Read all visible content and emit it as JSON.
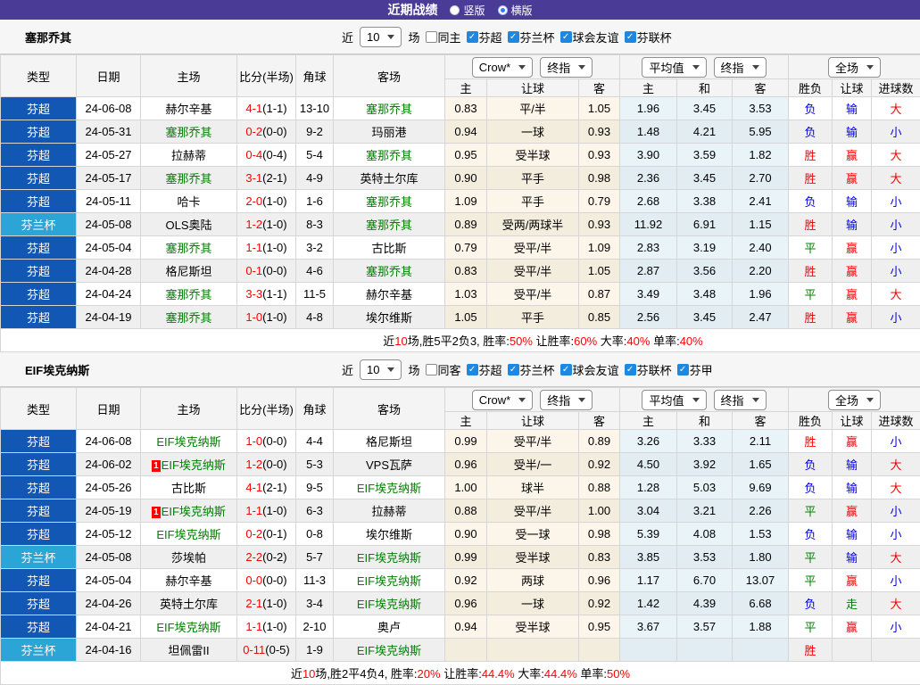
{
  "title_bar": {
    "title": "近期战绩",
    "options": [
      {
        "label": "竖版",
        "selected": false
      },
      {
        "label": "横版",
        "selected": true
      }
    ]
  },
  "columns": {
    "main": [
      "类型",
      "日期",
      "主场",
      "比分(半场)",
      "角球",
      "客场"
    ],
    "sub": [
      "主",
      "让球",
      "客",
      "主",
      "和",
      "客",
      "胜负",
      "让球",
      "进球数"
    ]
  },
  "colors": {
    "header_bar": "#4a3b96",
    "league_super": "#1257b4",
    "league_cup": "#2ba5d5",
    "win_red": "#ff0000",
    "loss_blue": "#0000ee",
    "draw_green": "#008000",
    "team_green": "#008000"
  },
  "sections": [
    {
      "team": "塞那乔其",
      "filter": {
        "near_label": "近",
        "count": "10",
        "games_label": "场",
        "same_label": "同主",
        "same_checked": false,
        "leagues": [
          {
            "label": "芬超",
            "checked": true
          },
          {
            "label": "芬兰杯",
            "checked": true
          },
          {
            "label": "球会友谊",
            "checked": true
          },
          {
            "label": "芬联杯",
            "checked": true
          }
        ]
      },
      "dropdowns": {
        "asia_source": "Crow*",
        "asia_time": "终指",
        "euro_source": "平均值",
        "euro_time": "终指",
        "scope": "全场"
      },
      "rows": [
        {
          "league": "芬超",
          "cup": false,
          "date": "24-06-08",
          "home": "赫尔辛基",
          "home_green": false,
          "home_red_card": false,
          "score": "4-1",
          "half": "(1-1)",
          "corner": "13-10",
          "away": "塞那乔其",
          "away_green": true,
          "asia": [
            "0.83",
            "平/半",
            "1.05"
          ],
          "euro": [
            "1.96",
            "3.45",
            "3.53"
          ],
          "results": [
            "负",
            "输",
            "大"
          ],
          "result_colors": [
            "b",
            "b",
            "r"
          ]
        },
        {
          "league": "芬超",
          "cup": false,
          "date": "24-05-31",
          "home": "塞那乔其",
          "home_green": true,
          "home_red_card": false,
          "score": "0-2",
          "half": "(0-0)",
          "corner": "9-2",
          "away": "玛丽港",
          "away_green": false,
          "asia": [
            "0.94",
            "一球",
            "0.93"
          ],
          "euro": [
            "1.48",
            "4.21",
            "5.95"
          ],
          "results": [
            "负",
            "输",
            "小"
          ],
          "result_colors": [
            "b",
            "b",
            "b"
          ]
        },
        {
          "league": "芬超",
          "cup": false,
          "date": "24-05-27",
          "home": "拉赫蒂",
          "home_green": false,
          "home_red_card": false,
          "score": "0-4",
          "half": "(0-4)",
          "corner": "5-4",
          "away": "塞那乔其",
          "away_green": true,
          "asia": [
            "0.95",
            "受半球",
            "0.93"
          ],
          "euro": [
            "3.90",
            "3.59",
            "1.82"
          ],
          "results": [
            "胜",
            "赢",
            "大"
          ],
          "result_colors": [
            "r",
            "r",
            "r"
          ]
        },
        {
          "league": "芬超",
          "cup": false,
          "date": "24-05-17",
          "home": "塞那乔其",
          "home_green": true,
          "home_red_card": false,
          "score": "3-1",
          "half": "(2-1)",
          "corner": "4-9",
          "away": "英特土尔库",
          "away_green": false,
          "asia": [
            "0.90",
            "平手",
            "0.98"
          ],
          "euro": [
            "2.36",
            "3.45",
            "2.70"
          ],
          "results": [
            "胜",
            "赢",
            "大"
          ],
          "result_colors": [
            "r",
            "r",
            "r"
          ]
        },
        {
          "league": "芬超",
          "cup": false,
          "date": "24-05-11",
          "home": "哈卡",
          "home_green": false,
          "home_red_card": false,
          "score": "2-0",
          "half": "(1-0)",
          "corner": "1-6",
          "away": "塞那乔其",
          "away_green": true,
          "asia": [
            "1.09",
            "平手",
            "0.79"
          ],
          "euro": [
            "2.68",
            "3.38",
            "2.41"
          ],
          "results": [
            "负",
            "输",
            "小"
          ],
          "result_colors": [
            "b",
            "b",
            "b"
          ]
        },
        {
          "league": "芬兰杯",
          "cup": true,
          "date": "24-05-08",
          "home": "OLS奥陆",
          "home_green": false,
          "home_red_card": false,
          "score": "1-2",
          "half": "(1-0)",
          "corner": "8-3",
          "away": "塞那乔其",
          "away_green": true,
          "asia": [
            "0.89",
            "受两/两球半",
            "0.93"
          ],
          "euro": [
            "11.92",
            "6.91",
            "1.15"
          ],
          "results": [
            "胜",
            "输",
            "小"
          ],
          "result_colors": [
            "r",
            "b",
            "b"
          ]
        },
        {
          "league": "芬超",
          "cup": false,
          "date": "24-05-04",
          "home": "塞那乔其",
          "home_green": true,
          "home_red_card": false,
          "score": "1-1",
          "half": "(1-0)",
          "corner": "3-2",
          "away": "古比斯",
          "away_green": false,
          "asia": [
            "0.79",
            "受平/半",
            "1.09"
          ],
          "euro": [
            "2.83",
            "3.19",
            "2.40"
          ],
          "results": [
            "平",
            "赢",
            "小"
          ],
          "result_colors": [
            "g",
            "r",
            "b"
          ]
        },
        {
          "league": "芬超",
          "cup": false,
          "date": "24-04-28",
          "home": "格尼斯坦",
          "home_green": false,
          "home_red_card": false,
          "score": "0-1",
          "half": "(0-0)",
          "corner": "4-6",
          "away": "塞那乔其",
          "away_green": true,
          "asia": [
            "0.83",
            "受平/半",
            "1.05"
          ],
          "euro": [
            "2.87",
            "3.56",
            "2.20"
          ],
          "results": [
            "胜",
            "赢",
            "小"
          ],
          "result_colors": [
            "r",
            "r",
            "b"
          ]
        },
        {
          "league": "芬超",
          "cup": false,
          "date": "24-04-24",
          "home": "塞那乔其",
          "home_green": true,
          "home_red_card": false,
          "score": "3-3",
          "half": "(1-1)",
          "corner": "11-5",
          "away": "赫尔辛基",
          "away_green": false,
          "asia": [
            "1.03",
            "受平/半",
            "0.87"
          ],
          "euro": [
            "3.49",
            "3.48",
            "1.96"
          ],
          "results": [
            "平",
            "赢",
            "大"
          ],
          "result_colors": [
            "g",
            "r",
            "r"
          ]
        },
        {
          "league": "芬超",
          "cup": false,
          "date": "24-04-19",
          "home": "塞那乔其",
          "home_green": true,
          "home_red_card": false,
          "score": "1-0",
          "half": "(1-0)",
          "corner": "4-8",
          "away": "埃尔维斯",
          "away_green": false,
          "asia": [
            "1.05",
            "平手",
            "0.85"
          ],
          "euro": [
            "2.56",
            "3.45",
            "2.47"
          ],
          "results": [
            "胜",
            "赢",
            "小"
          ],
          "result_colors": [
            "r",
            "r",
            "b"
          ]
        }
      ],
      "summary": [
        {
          "text": "近",
          "red": false
        },
        {
          "text": "10",
          "red": true
        },
        {
          "text": "场,胜5平2负3, 胜率:",
          "red": false
        },
        {
          "text": "50%",
          "red": true
        },
        {
          "text": " 让胜率:",
          "red": false
        },
        {
          "text": "60%",
          "red": true
        },
        {
          "text": " 大率:",
          "red": false
        },
        {
          "text": "40%",
          "red": true
        },
        {
          "text": " 单率:",
          "red": false
        },
        {
          "text": "40%",
          "red": true
        }
      ]
    },
    {
      "team": "EIF埃克纳斯",
      "filter": {
        "near_label": "近",
        "count": "10",
        "games_label": "场",
        "same_label": "同客",
        "same_checked": false,
        "leagues": [
          {
            "label": "芬超",
            "checked": true
          },
          {
            "label": "芬兰杯",
            "checked": true
          },
          {
            "label": "球会友谊",
            "checked": true
          },
          {
            "label": "芬联杯",
            "checked": true
          },
          {
            "label": "芬甲",
            "checked": true
          }
        ]
      },
      "dropdowns": {
        "asia_source": "Crow*",
        "asia_time": "终指",
        "euro_source": "平均值",
        "euro_time": "终指",
        "scope": "全场"
      },
      "rows": [
        {
          "league": "芬超",
          "cup": false,
          "date": "24-06-08",
          "home": "EIF埃克纳斯",
          "home_green": true,
          "home_red_card": false,
          "score": "1-0",
          "half": "(0-0)",
          "corner": "4-4",
          "away": "格尼斯坦",
          "away_green": false,
          "asia": [
            "0.99",
            "受平/半",
            "0.89"
          ],
          "euro": [
            "3.26",
            "3.33",
            "2.11"
          ],
          "results": [
            "胜",
            "赢",
            "小"
          ],
          "result_colors": [
            "r",
            "r",
            "b"
          ]
        },
        {
          "league": "芬超",
          "cup": false,
          "date": "24-06-02",
          "home": "EIF埃克纳斯",
          "home_green": true,
          "home_red_card": true,
          "score": "1-2",
          "half": "(0-0)",
          "corner": "5-3",
          "away": "VPS瓦萨",
          "away_green": false,
          "asia": [
            "0.96",
            "受半/一",
            "0.92"
          ],
          "euro": [
            "4.50",
            "3.92",
            "1.65"
          ],
          "results": [
            "负",
            "输",
            "大"
          ],
          "result_colors": [
            "b",
            "b",
            "r"
          ]
        },
        {
          "league": "芬超",
          "cup": false,
          "date": "24-05-26",
          "home": "古比斯",
          "home_green": false,
          "home_red_card": false,
          "score": "4-1",
          "half": "(2-1)",
          "corner": "9-5",
          "away": "EIF埃克纳斯",
          "away_green": true,
          "asia": [
            "1.00",
            "球半",
            "0.88"
          ],
          "euro": [
            "1.28",
            "5.03",
            "9.69"
          ],
          "results": [
            "负",
            "输",
            "大"
          ],
          "result_colors": [
            "b",
            "b",
            "r"
          ]
        },
        {
          "league": "芬超",
          "cup": false,
          "date": "24-05-19",
          "home": "EIF埃克纳斯",
          "home_green": true,
          "home_red_card": true,
          "score": "1-1",
          "half": "(1-0)",
          "corner": "6-3",
          "away": "拉赫蒂",
          "away_green": false,
          "asia": [
            "0.88",
            "受平/半",
            "1.00"
          ],
          "euro": [
            "3.04",
            "3.21",
            "2.26"
          ],
          "results": [
            "平",
            "赢",
            "小"
          ],
          "result_colors": [
            "g",
            "r",
            "b"
          ]
        },
        {
          "league": "芬超",
          "cup": false,
          "date": "24-05-12",
          "home": "EIF埃克纳斯",
          "home_green": true,
          "home_red_card": false,
          "score": "0-2",
          "half": "(0-1)",
          "corner": "0-8",
          "away": "埃尔维斯",
          "away_green": false,
          "asia": [
            "0.90",
            "受一球",
            "0.98"
          ],
          "euro": [
            "5.39",
            "4.08",
            "1.53"
          ],
          "results": [
            "负",
            "输",
            "小"
          ],
          "result_colors": [
            "b",
            "b",
            "b"
          ]
        },
        {
          "league": "芬兰杯",
          "cup": true,
          "date": "24-05-08",
          "home": "莎埃帕",
          "home_green": false,
          "home_red_card": false,
          "score": "2-2",
          "half": "(0-2)",
          "corner": "5-7",
          "away": "EIF埃克纳斯",
          "away_green": true,
          "asia": [
            "0.99",
            "受半球",
            "0.83"
          ],
          "euro": [
            "3.85",
            "3.53",
            "1.80"
          ],
          "results": [
            "平",
            "输",
            "大"
          ],
          "result_colors": [
            "g",
            "b",
            "r"
          ]
        },
        {
          "league": "芬超",
          "cup": false,
          "date": "24-05-04",
          "home": "赫尔辛基",
          "home_green": false,
          "home_red_card": false,
          "score": "0-0",
          "half": "(0-0)",
          "corner": "11-3",
          "away": "EIF埃克纳斯",
          "away_green": true,
          "asia": [
            "0.92",
            "两球",
            "0.96"
          ],
          "euro": [
            "1.17",
            "6.70",
            "13.07"
          ],
          "results": [
            "平",
            "赢",
            "小"
          ],
          "result_colors": [
            "g",
            "r",
            "b"
          ]
        },
        {
          "league": "芬超",
          "cup": false,
          "date": "24-04-26",
          "home": "英特土尔库",
          "home_green": false,
          "home_red_card": false,
          "score": "2-1",
          "half": "(1-0)",
          "corner": "3-4",
          "away": "EIF埃克纳斯",
          "away_green": true,
          "asia": [
            "0.96",
            "一球",
            "0.92"
          ],
          "euro": [
            "1.42",
            "4.39",
            "6.68"
          ],
          "results": [
            "负",
            "走",
            "大"
          ],
          "result_colors": [
            "b",
            "g",
            "r"
          ]
        },
        {
          "league": "芬超",
          "cup": false,
          "date": "24-04-21",
          "home": "EIF埃克纳斯",
          "home_green": true,
          "home_red_card": false,
          "score": "1-1",
          "half": "(1-0)",
          "corner": "2-10",
          "away": "奥卢",
          "away_green": false,
          "asia": [
            "0.94",
            "受半球",
            "0.95"
          ],
          "euro": [
            "3.67",
            "3.57",
            "1.88"
          ],
          "results": [
            "平",
            "赢",
            "小"
          ],
          "result_colors": [
            "g",
            "r",
            "b"
          ]
        },
        {
          "league": "芬兰杯",
          "cup": true,
          "date": "24-04-16",
          "home": "坦佩雷II",
          "home_green": false,
          "home_red_card": false,
          "score": "0-11",
          "half": "(0-5)",
          "corner": "1-9",
          "away": "EIF埃克纳斯",
          "away_green": true,
          "asia": [
            "",
            "",
            ""
          ],
          "euro": [
            "",
            "",
            ""
          ],
          "results": [
            "胜",
            "",
            ""
          ],
          "result_colors": [
            "r",
            "",
            ""
          ]
        }
      ],
      "summary": [
        {
          "text": "近",
          "red": false
        },
        {
          "text": "10",
          "red": true
        },
        {
          "text": "场,胜2平4负4, 胜率:",
          "red": false
        },
        {
          "text": "20%",
          "red": true
        },
        {
          "text": " 让胜率:",
          "red": false
        },
        {
          "text": "44.4%",
          "red": true
        },
        {
          "text": " 大率:",
          "red": false
        },
        {
          "text": "44.4%",
          "red": true
        },
        {
          "text": " 单率:",
          "red": false
        },
        {
          "text": "50%",
          "red": true
        }
      ]
    }
  ]
}
